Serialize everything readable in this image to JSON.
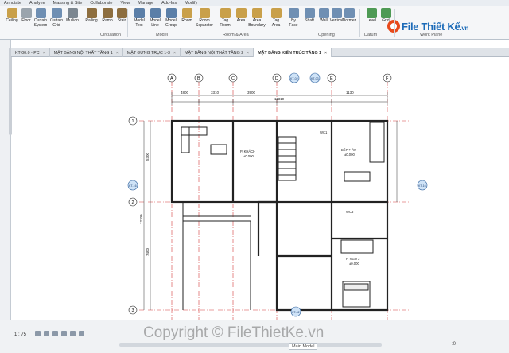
{
  "ribbon_tabs": [
    "Annotate",
    "Analyze",
    "Massing & Site",
    "Collaborate",
    "View",
    "Manage",
    "Add-Ins",
    "Modify"
  ],
  "tools": [
    {
      "label": "Ceiling",
      "icon": "ceiling-icon"
    },
    {
      "label": "Floor",
      "icon": "floor-icon"
    },
    {
      "label": "Curtain\nSystem",
      "icon": "curtain-system-icon"
    },
    {
      "label": "Curtain\nGrid",
      "icon": "curtain-grid-icon"
    },
    {
      "label": "Mullion",
      "icon": "mullion-icon"
    },
    {
      "label": "Railing",
      "icon": "railing-icon"
    },
    {
      "label": "Ramp",
      "icon": "ramp-icon"
    },
    {
      "label": "Stair",
      "icon": "stair-icon"
    },
    {
      "label": "Model\nText",
      "icon": "model-text-icon"
    },
    {
      "label": "Model\nLine",
      "icon": "model-line-icon"
    },
    {
      "label": "Model\nGroup",
      "icon": "model-group-icon"
    },
    {
      "label": "Room",
      "icon": "room-icon"
    },
    {
      "label": "Room\nSeparator",
      "icon": "room-separator-icon"
    },
    {
      "label": "Tag\nRoom",
      "icon": "tag-room-icon"
    },
    {
      "label": "Area",
      "icon": "area-icon"
    },
    {
      "label": "Area\nBoundary",
      "icon": "area-boundary-icon"
    },
    {
      "label": "Tag\nArea",
      "icon": "tag-area-icon"
    },
    {
      "label": "By\nFace",
      "icon": "by-face-icon"
    },
    {
      "label": "Shaft",
      "icon": "shaft-icon"
    },
    {
      "label": "Wall",
      "icon": "wall-opening-icon"
    },
    {
      "label": "Vertical",
      "icon": "vertical-icon"
    },
    {
      "label": "Dormer",
      "icon": "dormer-icon"
    },
    {
      "label": "Level",
      "icon": "level-icon"
    },
    {
      "label": "Grid",
      "icon": "grid-icon"
    }
  ],
  "panels": [
    "Circulation",
    "Model",
    "Room & Area",
    "Opening",
    "Datum",
    "Work Plane"
  ],
  "logo": {
    "brand": "File Thiết Kế",
    "suffix": ".vn"
  },
  "doc_tabs": [
    {
      "label": "KT-00.0 - PC"
    },
    {
      "label": "MẶT BẰNG NỘI THẤT TẦNG 1"
    },
    {
      "label": "MẶT ĐỨNG TRỤC 1-3"
    },
    {
      "label": "MẶT BẰNG NỘI THẤT TẦNG 2"
    },
    {
      "label": "MẶT BẰNG KIẾN TRÚC TẦNG 1",
      "active": true
    }
  ],
  "drawing": {
    "grid_top": [
      "A",
      "B",
      "C",
      "D",
      "E",
      "F"
    ],
    "grid_left": [
      "1",
      "2",
      "3"
    ],
    "dims_top": [
      "4800",
      "3310",
      "3900",
      "1130"
    ],
    "dim_total": "11310",
    "dims_left": [
      "5300",
      "7400"
    ],
    "dim_left_total": "12700",
    "rooms": [
      {
        "name": "P. KHÁCH",
        "level": "±0.000"
      },
      {
        "name": "WC1",
        "level": ""
      },
      {
        "name": "BẾP + ĂN",
        "level": "±0.000"
      },
      {
        "name": "WC3",
        "level": ""
      },
      {
        "name": "P. NGỦ 3",
        "level": "±0.000"
      }
    ],
    "section_tags": [
      "KT-02",
      "KT-03",
      "KT-03",
      "KT-02"
    ],
    "elev_tags": [
      "KT-16",
      "KT-16"
    ]
  },
  "status": {
    "scale": "1 : 75",
    "model": "Main Model",
    "zero": ":0"
  },
  "watermark": "Copyright © FileThietKe.vn",
  "colors": {
    "ribbon": "#f5f6f8",
    "accent": "#1c6bb8",
    "grid_line": "#d23b3b",
    "wall": "#222222"
  }
}
